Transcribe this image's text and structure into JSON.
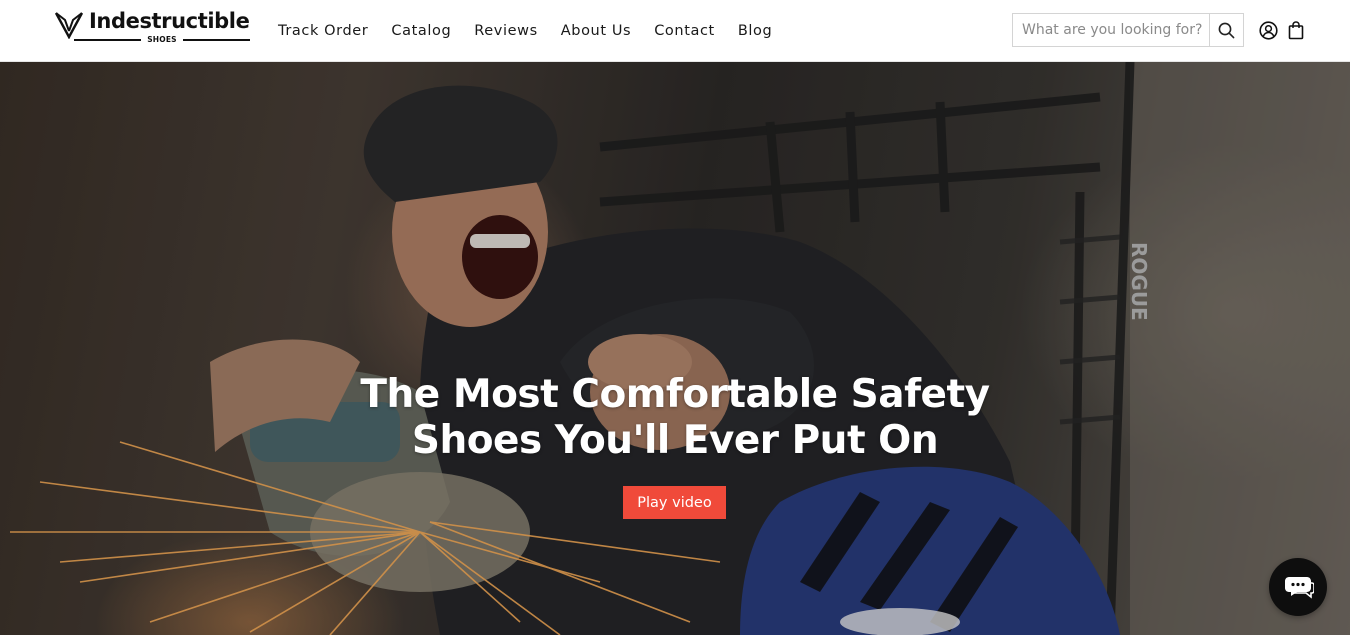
{
  "header": {
    "logo": {
      "wordmark": "Indestructible",
      "subtext": "SHOES"
    },
    "nav": [
      {
        "label": "Track Order"
      },
      {
        "label": "Catalog"
      },
      {
        "label": "Reviews"
      },
      {
        "label": "About Us"
      },
      {
        "label": "Contact"
      },
      {
        "label": "Blog"
      }
    ],
    "search": {
      "placeholder": "What are you looking for?",
      "icon": "search-icon"
    },
    "icons": {
      "account": "user-circle-icon",
      "cart": "shopping-bag-icon"
    }
  },
  "hero": {
    "title_line1": "The Most Comfortable Safety",
    "title_line2": "Shoes You'll Ever Put On",
    "button_label": "Play video",
    "background_text": "ROGUE"
  },
  "chat": {
    "icon": "chat-bubbles-icon"
  },
  "colors": {
    "accent": "#f04a3a",
    "header_bg": "#ffffff",
    "chat_bg": "#0e0e0e"
  }
}
